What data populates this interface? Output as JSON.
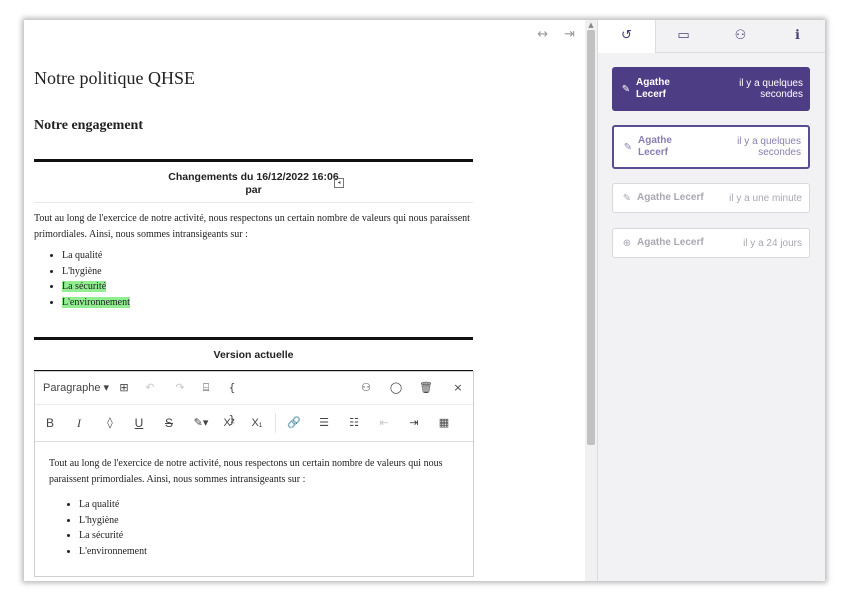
{
  "toolbar_top": {
    "resize_icon": "horizontal-resize-icon",
    "collapse_icon": "collapse-to-right-icon"
  },
  "document": {
    "title": "Notre politique QHSE",
    "section_title": "Notre engagement",
    "changes": {
      "header_line1": "Changements du 16/12/2022 16:06",
      "header_line2": "par",
      "paragraph": "Tout au long de l'exercice de notre activité, nous respectons un certain nombre de valeurs qui nous paraissent primordiales. Ainsi, nous sommes intransigeants sur :",
      "items": [
        "La qualité",
        "L'hygiène",
        "La sécurité",
        "L'environnement"
      ],
      "highlight_color": "#90ee90"
    },
    "current_label": "Version actuelle"
  },
  "editor": {
    "format_select": "Paragraphe",
    "content_paragraph": "Tout au long de l'exercice de notre activité, nous respectons un certain nombre de valeurs qui nous paraissent primordiales. Ainsi, nous sommes intransigeants sur :",
    "content_items": [
      "La qualité",
      "L'hygiène",
      "La sécurité",
      "L'environnement"
    ]
  },
  "sidebar": {
    "tabs": [
      "history-icon",
      "comments-icon",
      "handshake-icon",
      "info-icon"
    ],
    "versions": [
      {
        "author": "Agathe Lecerf",
        "time": "il y a quelques secondes",
        "icon": "pencil-icon",
        "state": "selected"
      },
      {
        "author": "Agathe Lecerf",
        "time": "il y a quelques secondes",
        "icon": "pencil-icon",
        "state": "compared"
      },
      {
        "author": "Agathe Lecerf",
        "time": "il y a une minute",
        "icon": "pencil-icon",
        "state": "normal"
      },
      {
        "author": "Agathe Lecerf",
        "time": "il y a 24 jours",
        "icon": "plus-circle-icon",
        "state": "normal"
      }
    ],
    "accent_color": "#4d3d84"
  }
}
